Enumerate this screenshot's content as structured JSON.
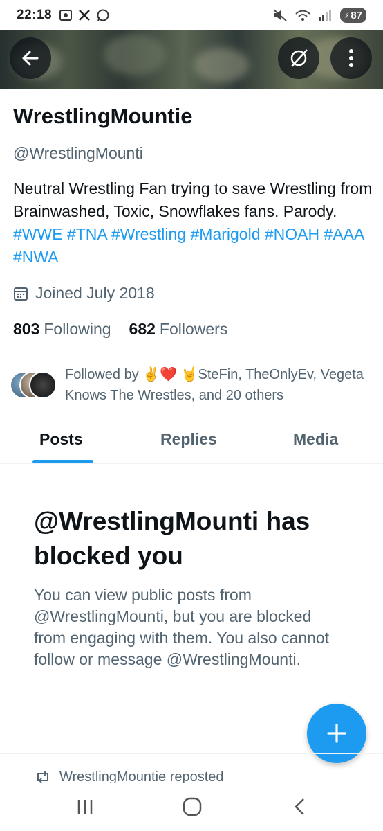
{
  "status_bar": {
    "time": "22:18",
    "battery": "87"
  },
  "profile": {
    "display_name": "WrestlingMountie",
    "handle": "@WrestlingMounti",
    "bio_text": "Neutral Wrestling Fan trying to save Wrestling from Brainwashed, Toxic, Snowflakes fans. Parody. ",
    "bio_hashtags": [
      "#WWE",
      "#TNA",
      "#Wrestling",
      "#Marigold",
      "#NOAH",
      "#AAA",
      "#NWA"
    ],
    "joined": "Joined July 2018",
    "following_count": "803",
    "following_label": "Following",
    "followers_count": "682",
    "followers_label": "Followers",
    "followed_by": "Followed by ✌️❤️ 🤘SteFin, TheOnlyEv, Vegeta Knows The Wrestles, and 20 others"
  },
  "tabs": [
    {
      "label": "Posts",
      "active": true
    },
    {
      "label": "Replies",
      "active": false
    },
    {
      "label": "Media",
      "active": false
    }
  ],
  "blocked": {
    "title": "@WrestlingMounti has blocked you",
    "body": "You can view public posts from @WrestlingMounti, but you are blocked from engaging with them. You also cannot follow or message @WrestlingMounti."
  },
  "repost_label": "WrestlingMountie reposted",
  "icons": {
    "back": "arrow-left-icon",
    "grok": "grok-icon",
    "more": "more-vertical-icon",
    "calendar": "calendar-icon",
    "fab": "plus-icon",
    "repost": "repost-icon"
  },
  "colors": {
    "accent": "#1d9bf0",
    "text": "#0f1419",
    "secondary": "#536471"
  }
}
